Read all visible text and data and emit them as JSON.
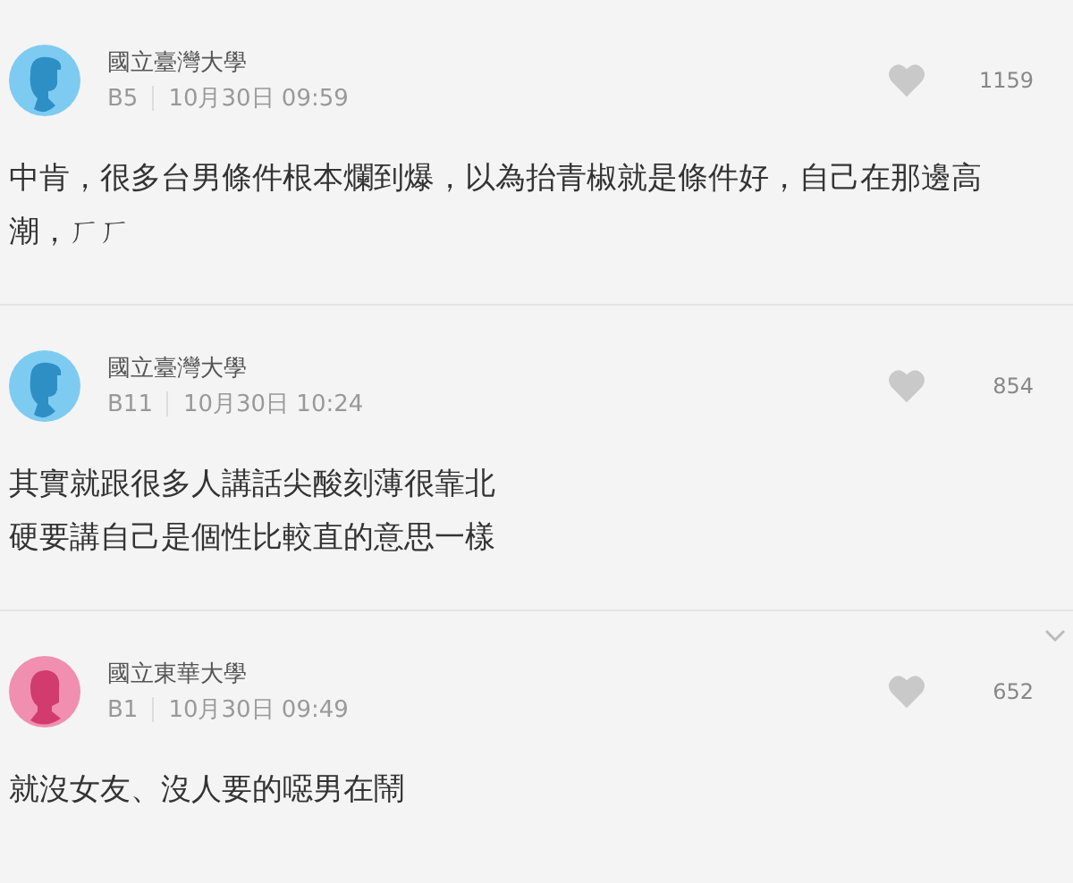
{
  "comments": [
    {
      "avatar": {
        "kind": "male"
      },
      "school": "國立臺灣大學",
      "floor": "B5",
      "date": "10月30日 09:59",
      "likes": "1159",
      "menu": false,
      "lines": [
        "中肯，很多台男條件根本爛到爆，以為抬青椒就是條件好，自己在那邊高",
        "潮，ㄏㄏ"
      ]
    },
    {
      "avatar": {
        "kind": "male"
      },
      "school": "國立臺灣大學",
      "floor": "B11",
      "date": "10月30日 10:24",
      "likes": "854",
      "menu": false,
      "lines": [
        "其實就跟很多人講話尖酸刻薄很靠北",
        "硬要講自己是個性比較直的意思一樣"
      ]
    },
    {
      "avatar": {
        "kind": "female"
      },
      "school": "國立東華大學",
      "floor": "B1",
      "date": "10月30日 09:49",
      "likes": "652",
      "menu": true,
      "lines": [
        "就沒女友、沒人要的噁男在鬧"
      ]
    }
  ]
}
